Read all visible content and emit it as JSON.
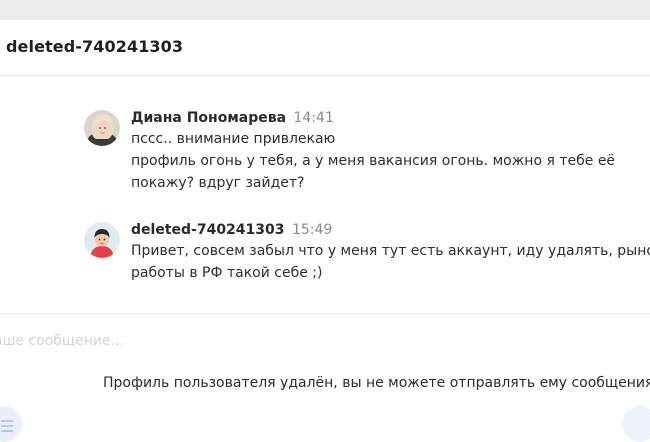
{
  "chat": {
    "title": "deleted-740241303"
  },
  "messages": [
    {
      "author": "Диана Пономарева",
      "time": "14:41",
      "lines": [
        "пссс.. внимание привлекаю",
        "профиль огонь у тебя, а у меня вакансия огонь. можно я тебе её",
        "покажу? вдруг зайдет?"
      ]
    },
    {
      "author": "deleted-740241303",
      "time": "15:49",
      "lines": [
        "Привет, совсем забыл что у меня тут есть аккаунт, иду удалять, рынок",
        "работы в РФ такой себе ;)"
      ]
    }
  ],
  "composer": {
    "placeholder": "аше сообщение..."
  },
  "notice": "Профиль пользователя удалён, вы не можете отправлять ему сообщения.",
  "colors": {
    "topbar": "#ececec",
    "time": "#8a8a8a",
    "placeholder": "#d3d3d3"
  }
}
